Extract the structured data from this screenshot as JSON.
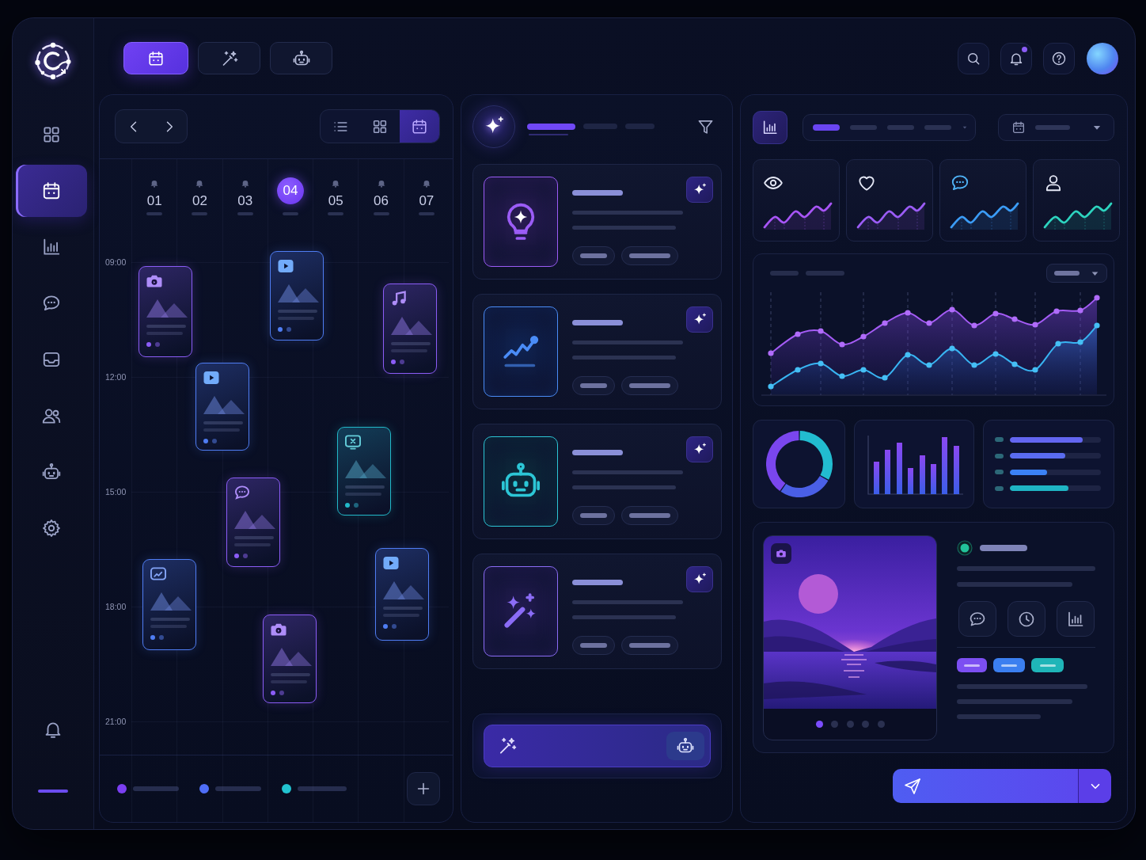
{
  "top_bar": {
    "tabs": [
      {
        "kind": "calendar",
        "selected": true
      },
      {
        "kind": "magic",
        "selected": false
      },
      {
        "kind": "robot",
        "selected": false
      }
    ],
    "notifications": {
      "unread": true
    }
  },
  "sidebar": {
    "items": [
      {
        "kind": "grid",
        "selected": false
      },
      {
        "kind": "calendar",
        "selected": true
      },
      {
        "kind": "chart",
        "selected": false
      },
      {
        "kind": "chat",
        "selected": false
      },
      {
        "kind": "inbox",
        "selected": false
      },
      {
        "kind": "users",
        "selected": false
      },
      {
        "kind": "robot",
        "selected": false
      },
      {
        "kind": "settings",
        "selected": false
      }
    ],
    "footer_items": [
      {
        "kind": "bell",
        "selected": false
      }
    ]
  },
  "calendar": {
    "views": [
      {
        "kind": "list",
        "selected": false
      },
      {
        "kind": "grid",
        "selected": false
      },
      {
        "kind": "calendar",
        "selected": true
      }
    ],
    "days": [
      {
        "label": "01",
        "selected": false
      },
      {
        "label": "02",
        "selected": false
      },
      {
        "label": "03",
        "selected": false
      },
      {
        "label": "04",
        "selected": true
      },
      {
        "label": "05",
        "selected": false
      },
      {
        "label": "06",
        "selected": false
      },
      {
        "label": "07",
        "selected": false
      }
    ],
    "times": [
      "09:00",
      "12:00",
      "15:00",
      "18:00",
      "21:00"
    ],
    "events": [
      {
        "kind": "camera",
        "color": "#8b5cf6"
      },
      {
        "kind": "video",
        "color": "#4f7df3"
      },
      {
        "kind": "music",
        "color": "#8b5cf6"
      },
      {
        "kind": "video",
        "color": "#4f7df3"
      },
      {
        "kind": "screen",
        "color": "#22b8c8"
      },
      {
        "kind": "chat",
        "color": "#8b5cf6"
      },
      {
        "kind": "board",
        "color": "#4f7df3"
      },
      {
        "kind": "video",
        "color": "#4f7df3"
      },
      {
        "kind": "camera",
        "color": "#8b5cf6"
      }
    ],
    "legend": [
      {
        "color": "#7b3ff2"
      },
      {
        "color": "#4f6ef7"
      },
      {
        "color": "#22c3d0"
      }
    ]
  },
  "assistant": {
    "tabs": [
      {
        "selected": true
      },
      {
        "selected": false
      },
      {
        "selected": false
      }
    ],
    "cards": [
      {
        "kind": "idea"
      },
      {
        "kind": "trend"
      },
      {
        "kind": "robot"
      },
      {
        "kind": "magic"
      }
    ]
  },
  "analytics": {
    "tabs": [
      {
        "selected": true
      },
      {
        "selected": false
      },
      {
        "selected": false
      },
      {
        "selected": false
      }
    ],
    "stats": [
      {
        "kind": "views",
        "color": "#a855f7"
      },
      {
        "kind": "likes",
        "color": "#9b5cf6"
      },
      {
        "kind": "comments",
        "color": "#3b9cf6"
      },
      {
        "kind": "followers",
        "color": "#2dd4bf"
      }
    ],
    "progress": [
      {
        "level": 0.8,
        "color": "#6366f1"
      },
      {
        "level": 0.61,
        "color": "#5a6cf0"
      },
      {
        "level": 0.41,
        "color": "#3b82f6"
      },
      {
        "level": 0.64,
        "color": "#1fb5c4"
      }
    ],
    "media": {
      "status": {
        "color": "#22c39a"
      },
      "slides": [
        {
          "selected": true
        },
        {
          "selected": false
        },
        {
          "selected": false
        },
        {
          "selected": false
        },
        {
          "selected": false
        }
      ],
      "actions": [
        {
          "kind": "chat"
        },
        {
          "kind": "clock"
        },
        {
          "kind": "chart"
        }
      ],
      "tags": [
        {
          "color": "#7c4ff2"
        },
        {
          "color": "#3b7ff0"
        },
        {
          "color": "#1fb5b8"
        }
      ]
    }
  }
}
